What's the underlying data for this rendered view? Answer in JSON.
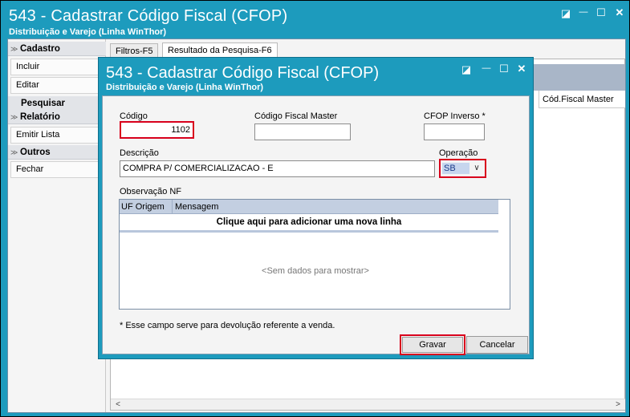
{
  "window": {
    "title": "543 - Cadastrar Código Fiscal (CFOP)",
    "subtitle": "Distribuição e Varejo (Linha WinThor)"
  },
  "window_controls": {
    "restore": "◪",
    "minimize": "—",
    "maximize": "☐",
    "close": "✕"
  },
  "sidebar": {
    "groups": [
      {
        "label": "Cadastro",
        "items": [
          "Incluir",
          "Editar"
        ]
      },
      {
        "label": "Pesquisar",
        "items": []
      },
      {
        "label": "Relatório",
        "items": [
          "Emitir Lista"
        ]
      },
      {
        "label": "Outros",
        "items": [
          "Fechar"
        ]
      }
    ],
    "chevron": "≫"
  },
  "tabs": [
    "Filtros-F5",
    "Resultado da Pesquisa-F6"
  ],
  "grid": {
    "columns": [
      "Cód.Fiscal Master"
    ],
    "scroll_left": "<",
    "scroll_right": ">"
  },
  "dialog": {
    "title": "543 - Cadastrar Código Fiscal (CFOP)",
    "subtitle": "Distribuição e Varejo (Linha WinThor)",
    "fields": {
      "codigo_label": "Código",
      "codigo_value": "1102",
      "master_label": "Código Fiscal Master",
      "master_value": "",
      "inverso_label": "CFOP Inverso *",
      "inverso_value": "",
      "descricao_label": "Descrição",
      "descricao_value": "COMPRA P/ COMERCIALIZACAO - E",
      "operacao_label": "Operação",
      "operacao_value": "SB",
      "dropdown_arrow": "∨"
    },
    "obs": {
      "label": "Observação NF",
      "columns": [
        "UF Origem",
        "Mensagem"
      ],
      "add_row": "Clique aqui para adicionar uma nova linha",
      "empty": "<Sem dados para mostrar>"
    },
    "footnote": "* Esse campo serve para devolução referente a venda.",
    "buttons": {
      "save": "Gravar",
      "cancel": "Cancelar"
    }
  },
  "colors": {
    "titlebar": "#1d9bbd",
    "highlight": "#d8001c",
    "grid_header": "#c3cfe1"
  }
}
